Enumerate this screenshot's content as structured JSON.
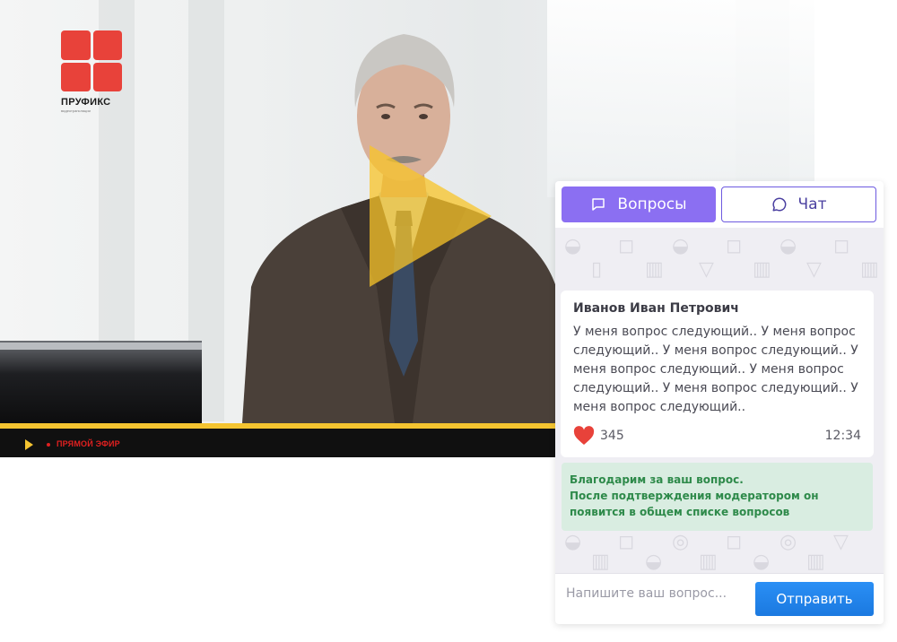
{
  "video": {
    "live_label": "ПРЯМОЙ ЭФИР",
    "accent_color": "#f4c430",
    "live_color": "#e02020"
  },
  "logo": {
    "name": "ПРУФИКС",
    "subtitle": "видеотрансляции",
    "color": "#e8423a"
  },
  "panel": {
    "tabs": [
      {
        "label": "Вопросы",
        "icon": "message-square-icon",
        "active": true
      },
      {
        "label": "Чат",
        "icon": "chat-bubble-icon",
        "active": false
      }
    ],
    "message": {
      "author": "Иванов Иван Петрович",
      "text": "У меня вопрос следующий.. У меня вопрос следующий.. У меня вопрос следующий.. У меня вопрос следующий.. У меня вопрос следующий.. У меня вопрос следующий.. У меня вопрос следующий..",
      "likes": "345",
      "time": "12:34"
    },
    "notice": {
      "line1": "Благодарим за ваш вопрос.",
      "line2": "После подтверждения модератором он появится в общем списке вопросов"
    },
    "composer": {
      "placeholder": "Напишите ваш вопрос...",
      "send_label": "Отправить"
    }
  },
  "colors": {
    "tab_active": "#8b6ff2",
    "send_button": "#1b79e0",
    "notice_bg": "#d9ede1",
    "notice_text": "#2e8a4a",
    "heart": "#e8423a"
  }
}
